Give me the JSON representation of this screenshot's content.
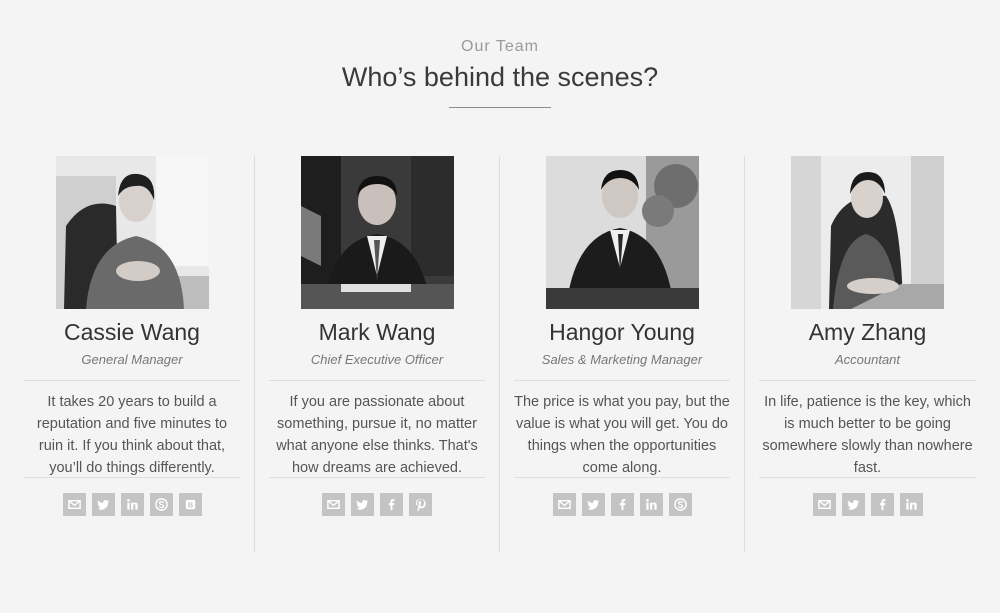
{
  "header": {
    "eyebrow": "Our Team",
    "headline": "Who’s behind the scenes?"
  },
  "members": [
    {
      "name": "Cassie Wang",
      "role": "General Manager",
      "quote": "It takes 20 years to build a reputation and five minutes to ruin it. If you think about that, you’ll do things differently.",
      "photo": "woman-in-office-chair-photo",
      "socials": [
        "mail-icon",
        "twitter-icon",
        "linkedin-icon",
        "skype-icon",
        "behance-icon"
      ]
    },
    {
      "name": "Mark Wang",
      "role": "Chief Executive Officer",
      "quote": "If you are passionate about something, pursue it, no matter what anyone else thinks. That's how dreams are achieved.",
      "photo": "man-in-suit-at-desk-photo",
      "socials": [
        "mail-icon",
        "twitter-icon",
        "facebook-icon",
        "pinterest-icon"
      ]
    },
    {
      "name": "Hangor Young",
      "role": "Sales & Marketing Manager",
      "quote": "The price is what you pay, but the value is what you will get. You do things when the opportunities come along.",
      "photo": "young-man-in-suit-photo",
      "socials": [
        "mail-icon",
        "twitter-icon",
        "facebook-icon",
        "linkedin-icon",
        "skype-icon"
      ]
    },
    {
      "name": "Amy Zhang",
      "role": "Accountant",
      "quote": "In life, patience is the key, which is much better to be going somewhere slowly than nowhere fast.",
      "photo": "woman-smiling-at-desk-photo",
      "socials": [
        "mail-icon",
        "twitter-icon",
        "facebook-icon",
        "linkedin-icon"
      ]
    }
  ],
  "colors": {
    "background": "#f4f4f4",
    "social_bg": "#c4c4c4",
    "divider": "#dcdcdc"
  }
}
